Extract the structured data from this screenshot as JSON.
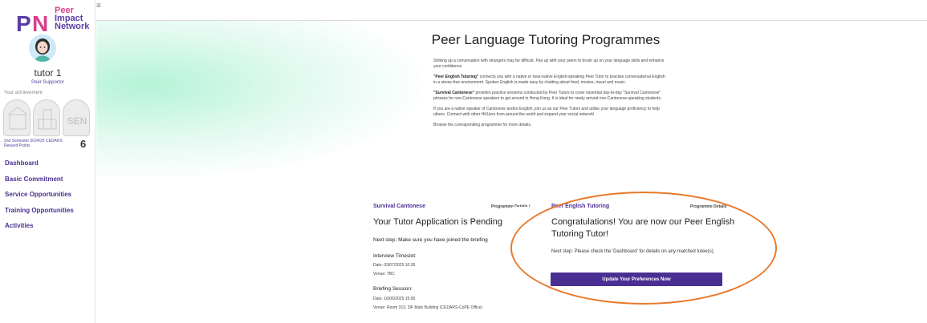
{
  "brand": {
    "logo_line1": "Peer",
    "logo_line2": "Impact",
    "logo_line3": "Network"
  },
  "user": {
    "name": "tutor 1",
    "role": "Peer Supportor",
    "achievement_label": "Your achievement",
    "points_label": "2nd Semester 2024/25 CEDARS Reward Points",
    "points_value": "6"
  },
  "badges": [
    "",
    "",
    "SEN"
  ],
  "nav": [
    "Dashboard",
    "Basic Commitment",
    "Service Opportunities",
    "Training Opportunities",
    "Activities"
  ],
  "page": {
    "title": "Peer Language Tutoring Programmes",
    "intro_1": "Striking up a conversation with strangers may be difficult. Pair up with your peers to brush up on your language skills and enhance your confidence.",
    "intro_2_bold": "\"Peer English Tutoring\"",
    "intro_2": " connects you with a native or near-native English-speaking Peer Tutor to practise conversational English in a stress-free environment. Spoken English is made easy by chatting about food, movies, travel and music.",
    "intro_3_bold": "\"Survival Cantonese\"",
    "intro_3": " provides practice sessions conducted by Peer Tutors to cover essential day-to-day \"Survival Cantonese\" phrases for non-Cantonese speakers to get around in Hong Kong. It is ideal for newly arrived non-Cantonese-speaking students.",
    "intro_4": "If you are a native speaker of Cantonese and/or English, join us as our Peer Tutors and utilise your language proficiency to help others. Connect with other HKUers from around the world and expand your social network!",
    "intro_5": "Browse the corresponding programme for more details."
  },
  "cantonese": {
    "title": "Survival Cantonese",
    "link": "Programme Details (",
    "status": "Your Tutor Application is Pending",
    "next_step": "Next step: Make sure you have joined the briefing",
    "interview_label": "Interview Timeslot:",
    "interview_date": "Date: 03/07/2025 10:30",
    "interview_venue": "Venue: TBC",
    "briefing_label": "Briefing Session:",
    "briefing_date": "Date: 16/06/2025 15:00",
    "briefing_venue": "Venue: Room 313, 3/F Main Building (CEDARS-CoPE Office)"
  },
  "english": {
    "title": "Peer English Tutoring",
    "link": "Programme Details",
    "congrats": "Congratulations! You are now our Peer English Tutoring Tutor!",
    "next_step": "Next step: Please check the 'Dashboard' for details on any matched tutee(s).",
    "button": "Update Your Preferences Now"
  }
}
